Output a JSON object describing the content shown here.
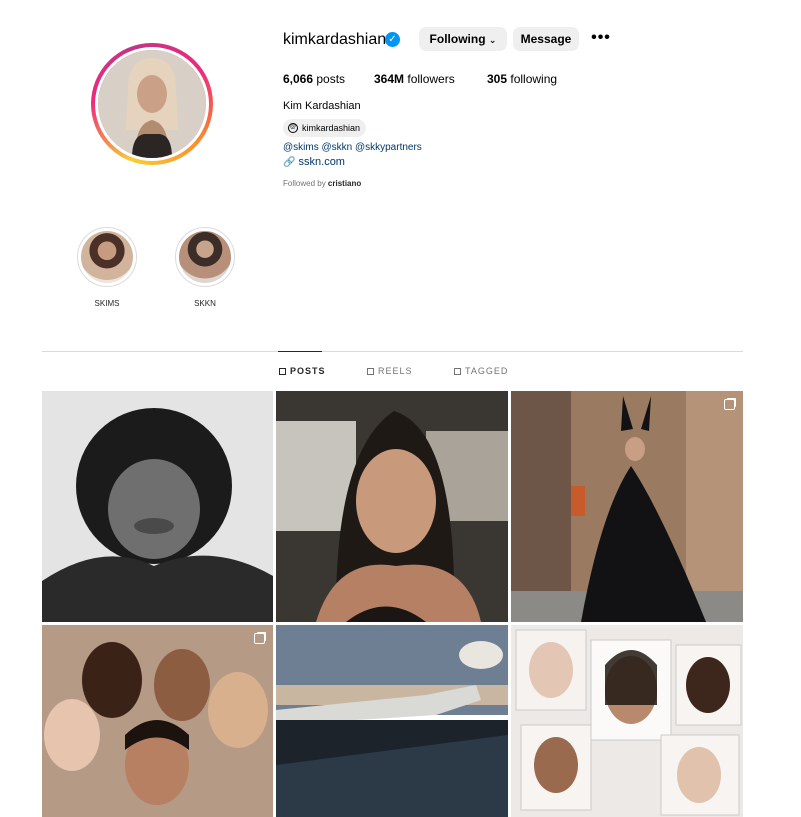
{
  "profile": {
    "username": "kimkardashian",
    "full_name": "Kim Kardashian",
    "threads_handle": "kimkardashian",
    "bio_mentions": "@skims @skkn @skkypartners",
    "link": "sskn.com",
    "followed_by_prefix": "Followed by",
    "followed_by_user": "cristiano"
  },
  "actions": {
    "following_label": "Following",
    "message_label": "Message",
    "more_label": "•••"
  },
  "stats": {
    "posts_count": "6,066",
    "posts_label": "posts",
    "followers_count": "364M",
    "followers_label": "followers",
    "following_count": "305",
    "following_label": "following"
  },
  "highlights": [
    {
      "label": "SKIMS"
    },
    {
      "label": "SKKN"
    }
  ],
  "tabs": {
    "posts": "POSTS",
    "reels": "REELS",
    "tagged": "TAGGED"
  },
  "colors": {
    "verified": "#0095f6",
    "link": "#00376b",
    "button_bg": "#efefef"
  }
}
